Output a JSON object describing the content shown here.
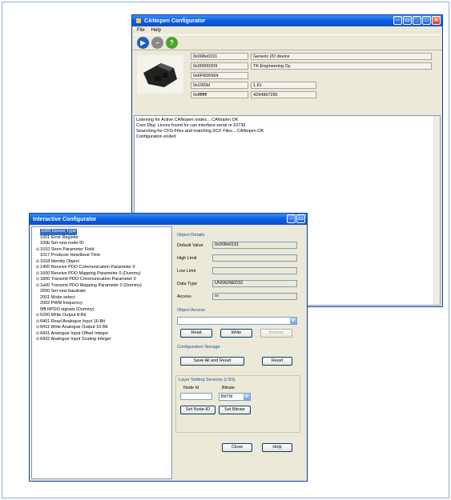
{
  "canopen_window": {
    "title": "CANopen Configurator",
    "menu": [
      "File",
      "Help"
    ],
    "device_info": {
      "col1": [
        "0x008e0191",
        "0x00000209",
        "0x6F6D6564",
        "0x1003d",
        "0xffffffff"
      ],
      "col2": [
        "Generic I/O device",
        "TK Engineering Oy",
        "1.61",
        "4294967295"
      ]
    },
    "log": [
      "Listening for Active CANopen nodes... CANopen OK",
      "Core Dbg: Licens found for can interface serial nr.10739",
      "Searching for CFG-Files and matching DCF Files... CANopen OK",
      "Configuration ended"
    ]
  },
  "interactive_window": {
    "title": "Interactive Configurator",
    "tree": [
      {
        "label": "1000 Device Type",
        "expand": false,
        "selected": true
      },
      {
        "label": "1001 Error Register",
        "expand": false,
        "selected": false
      },
      {
        "label": "100b Set new node-ID",
        "expand": false,
        "selected": false
      },
      {
        "label": "1010 Store Parameter Field",
        "expand": true,
        "selected": false
      },
      {
        "label": "1017 Producer Heartbeat Time",
        "expand": false,
        "selected": false
      },
      {
        "label": "1018 Identity Object",
        "expand": true,
        "selected": false
      },
      {
        "label": "1400 Receive PDO Communication Parameter 0",
        "expand": true,
        "selected": false
      },
      {
        "label": "1600 Receive PDO Mapping Parameter 0 (Dummy)",
        "expand": true,
        "selected": false
      },
      {
        "label": "1800 Transmit PDO Communication Parameter 0",
        "expand": true,
        "selected": false
      },
      {
        "label": "1a00 Transmit PDO Mapping Parameter 0 (Dummy)",
        "expand": true,
        "selected": false
      },
      {
        "label": "2000 Set new baudrate",
        "expand": false,
        "selected": false
      },
      {
        "label": "2001 Mode select",
        "expand": false,
        "selected": false
      },
      {
        "label": "2002 PWM frequency",
        "expand": false,
        "selected": false
      },
      {
        "label": "5fff RPDO signals (Dummy)",
        "expand": false,
        "selected": false
      },
      {
        "label": "6200 Write Output 8-Bit",
        "expand": true,
        "selected": false
      },
      {
        "label": "6401 Read Analogue Input 16-Bit",
        "expand": true,
        "selected": false
      },
      {
        "label": "6411 Write Analogue Output 16-Bit",
        "expand": true,
        "selected": false
      },
      {
        "label": "6431 Analogue Input Offset Integer",
        "expand": true,
        "selected": false
      },
      {
        "label": "6432 Analogue Input Scaling Integer",
        "expand": true,
        "selected": false
      }
    ],
    "object_details": {
      "title": "Object Details",
      "default_value_label": "Default Value",
      "default_value": "0x008e0191",
      "high_limit_label": "High Limit",
      "high_limit": "",
      "low_limit_label": "Low Limit",
      "low_limit": "",
      "data_type_label": "Data Type",
      "data_type": "UNSIGNED32",
      "access_label": "Access",
      "access": "ro"
    },
    "object_access": {
      "title": "Object Access",
      "value": "",
      "read": "Read",
      "write": "Write",
      "browse": "Browse"
    },
    "configuration_storage": {
      "title": "Configuration Storage",
      "save_all": "Save All and Reset",
      "reset": "Reset"
    },
    "lss": {
      "title": "Layer Setting Services (LSS)",
      "node_id_label": "Node Id",
      "node_id": "",
      "bitrate_label": "Bitrate",
      "bitrate": "BitTM",
      "set_node_id": "Set Node-ID",
      "set_bitrate": "Set Bitrate"
    },
    "close": "Close",
    "help": "Help"
  }
}
